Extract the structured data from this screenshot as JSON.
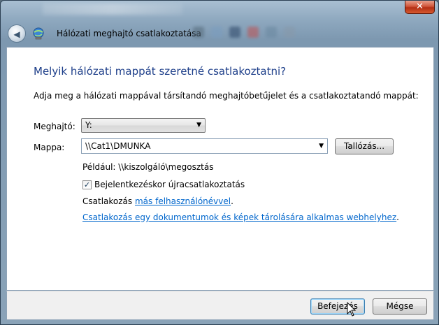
{
  "window": {
    "title": "Hálózati meghajtó csatlakoztatása",
    "close_glyph": "✕",
    "back_glyph": "◀"
  },
  "page": {
    "heading": "Melyik hálózati mappát szeretné csatlakoztatni?",
    "instruction": "Adja meg a hálózati mappával társítandó meghajtóbetűjelet és a csatlakoztatandó mappát:",
    "drive_label": "Meghajtó:",
    "drive_value": "Y:",
    "folder_label": "Mappa:",
    "folder_value": "\\\\Cat1\\DMUNKA",
    "browse_button": "Tallózás...",
    "example_text": "Például: \\\\kiszolgáló\\megosztás",
    "reconnect_label": "Bejelentkezéskor újracsatlakoztatás",
    "reconnect_checked": true,
    "connect_as_prefix": "Csatlakozás",
    "connect_as_link": "más felhasználónévvel",
    "connect_as_suffix": ".",
    "website_link": "Csatlakozás egy dokumentumok és képek tárolására alkalmas webhelyhez",
    "website_suffix": "."
  },
  "footer": {
    "finish_button": "Befejezés",
    "cancel_button": "Mégse"
  },
  "colors": {
    "heading": "#1e3f8a",
    "link": "#0066cc",
    "close": "#c9432a"
  }
}
